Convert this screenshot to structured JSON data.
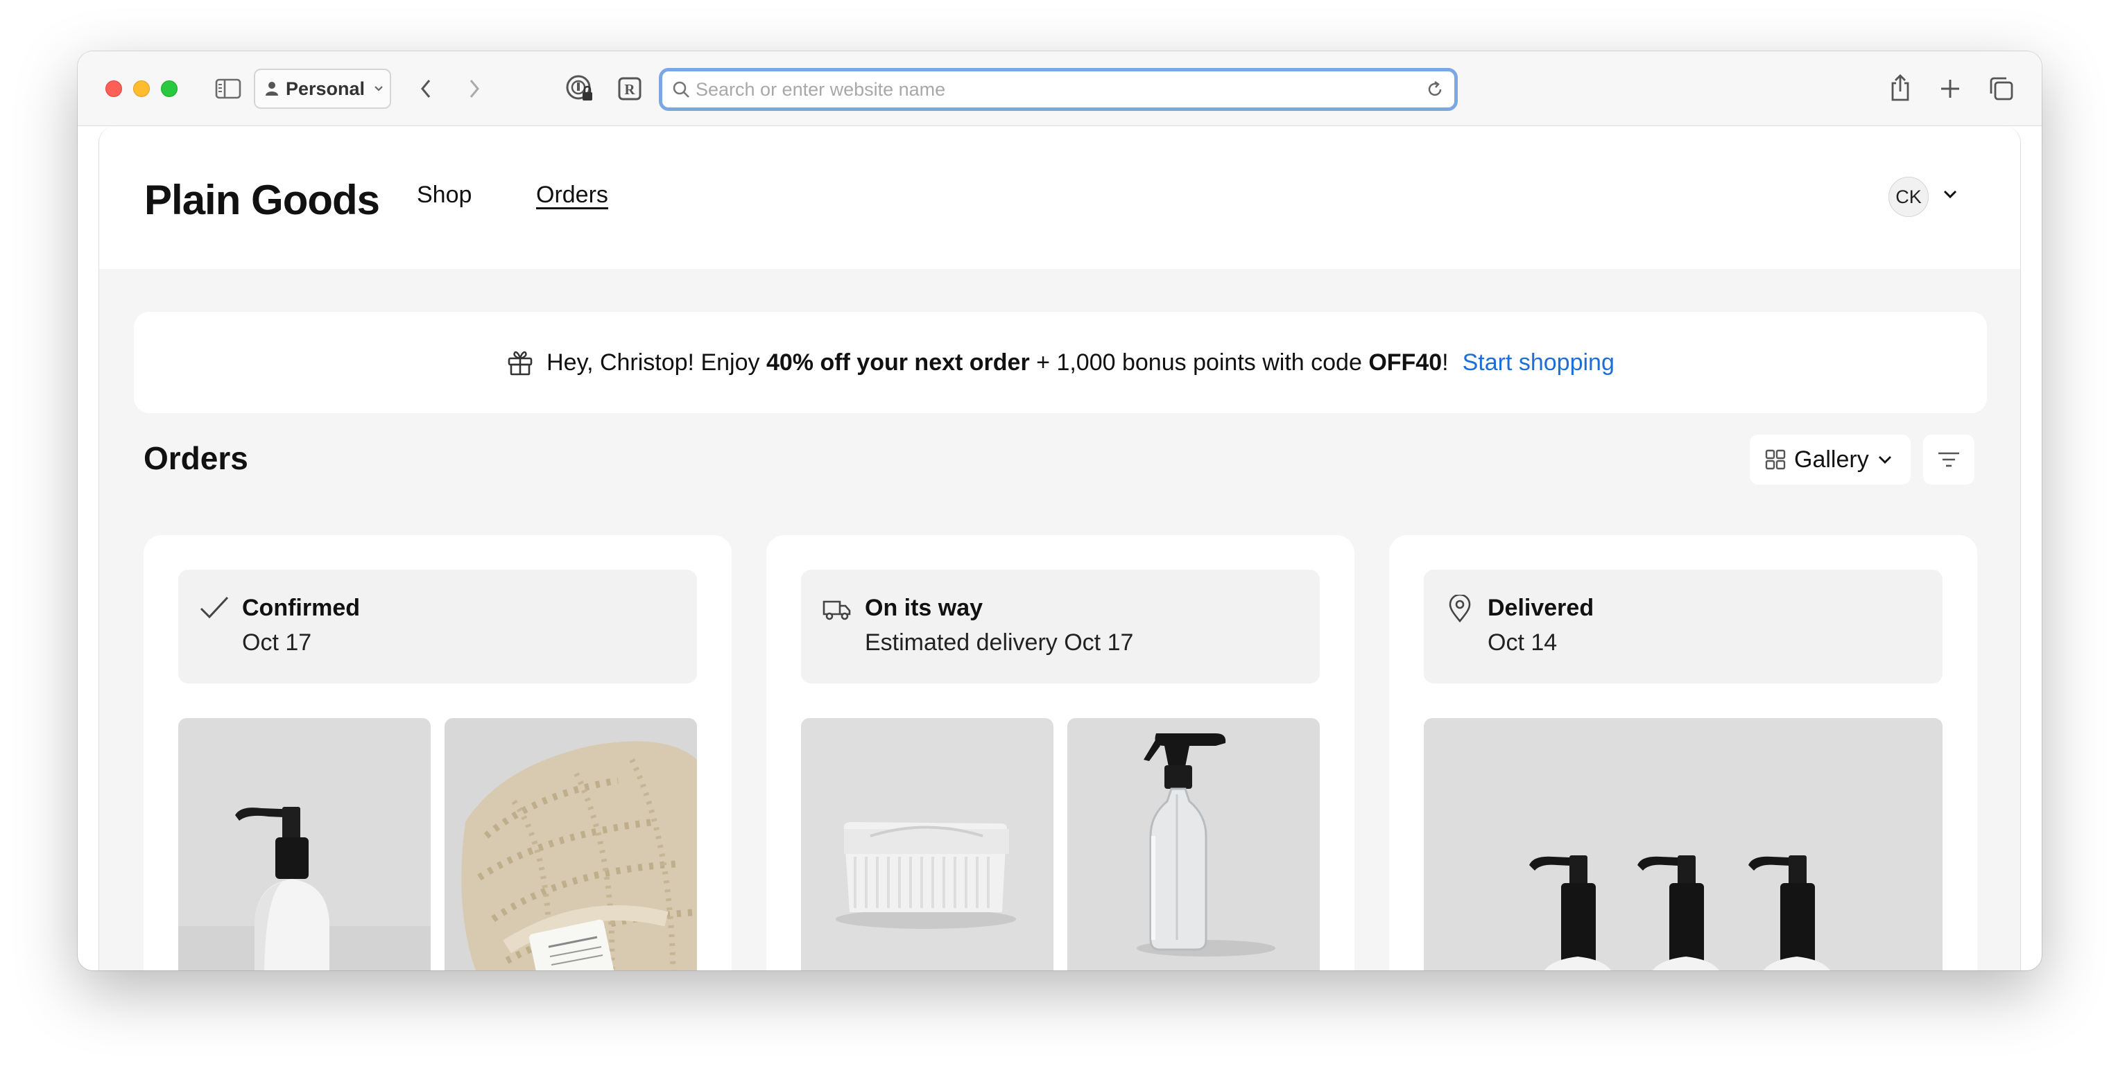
{
  "browser": {
    "profile_label": "Personal",
    "address_placeholder": "Search or enter website name",
    "address_value": ""
  },
  "site": {
    "brand": "Plain Goods",
    "nav": [
      {
        "label": "Shop"
      },
      {
        "label": "Orders"
      }
    ],
    "user_initials": "CK"
  },
  "promo": {
    "text_1": "Hey, Christop! Enjoy ",
    "bold_1": "40% off your next order",
    "text_2": " + 1,000 bonus points with code ",
    "code": "OFF40",
    "text_3": "!",
    "link": "Start shopping"
  },
  "orders": {
    "title": "Orders",
    "view_label": "Gallery",
    "items": [
      {
        "status": "Confirmed",
        "detail": "Oct 17",
        "icon": "checkmark-icon"
      },
      {
        "status": "On its way",
        "detail": "Estimated delivery Oct 17",
        "icon": "delivery-truck-icon"
      },
      {
        "status": "Delivered",
        "detail": "Oct 14",
        "icon": "location-pin-icon"
      }
    ]
  },
  "colors": {
    "accent_link": "#1d6fd6",
    "address_focus": "#7ba7e2",
    "page_bg": "#f5f5f5"
  }
}
